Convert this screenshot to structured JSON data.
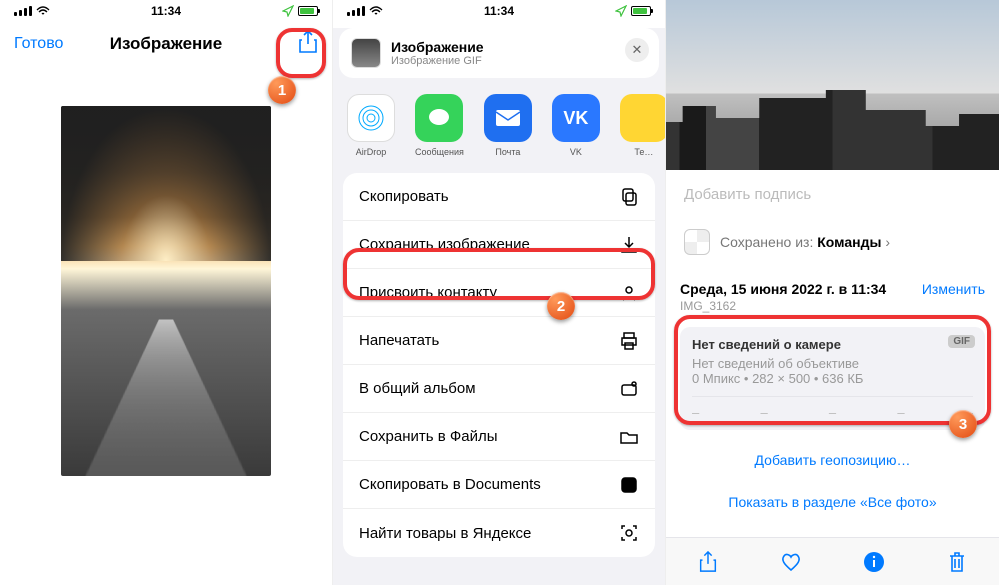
{
  "accent": "#007aff",
  "status": {
    "time": "11:34"
  },
  "phone1": {
    "done": "Готово",
    "title": "Изображение"
  },
  "phone2": {
    "sheet_title": "Изображение",
    "sheet_subtitle": "Изображение GIF",
    "apps": [
      "AirDrop",
      "Сообщения",
      "Почта",
      "VK",
      "Те…"
    ],
    "actions": [
      "Скопировать",
      "Сохранить изображение",
      "Присвоить контакту",
      "Напечатать",
      "В общий альбом",
      "Сохранить в Файлы",
      "Скопировать в Documents",
      "Найти товары в Яндексе"
    ]
  },
  "phone3": {
    "caption_placeholder": "Добавить подпись",
    "saved_prefix": "Сохранено из: ",
    "saved_app": "Команды",
    "date": "Среда, 15 июня 2022 г. в 11:34",
    "change": "Изменить",
    "filename": "IMG_3162",
    "meta": {
      "camera": "Нет сведений о камере",
      "badge": "GIF",
      "lens": "Нет сведений об объективе",
      "stats": "0 Мпикс  •  282 × 500  •  636 КБ"
    },
    "add_geo": "Добавить геопозицию…",
    "show_all": "Показать в разделе «Все фото»"
  },
  "markers": {
    "b1": "1",
    "b2": "2",
    "b3": "3"
  }
}
